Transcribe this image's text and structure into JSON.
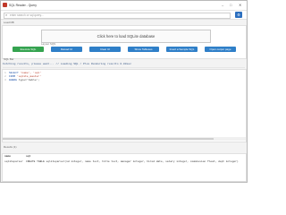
{
  "window": {
    "title": "SQL Reader - Query",
    "minimize_icon": "minimize-icon",
    "maximize_icon": "maximize-icon",
    "close_icon": "close-icon"
  },
  "search": {
    "placeholder": "enter search or sql query...",
    "icon": "search-icon",
    "settings_icon": "settings-icon"
  },
  "load_db": {
    "section_label": "Load DB",
    "drop_zone_text": "Click here to load SQLite database",
    "loaded_status": "Layout SQS"
  },
  "toolbar": {
    "execute_label": "Execute SQL",
    "reload_label": "Reload UI",
    "clear_label": "Clear UI",
    "show_tables_label": "Show Tableses",
    "insert_sample_label": "Insert a Sample SQL",
    "open_output_label": "Open output page"
  },
  "query": {
    "section_label": "SQL Bar",
    "status": "Fetching results, please wait... // Loading SQL / Plus Rendering results 0.00sec",
    "lines": [
      {
        "num": "1",
        "kw1": "SELECT",
        "rest1": " 'name', 'sql'"
      },
      {
        "num": "2",
        "kw1": "FROM",
        "rest1": " 'sqlite_master'"
      },
      {
        "num": "3",
        "kw1": "WHERE",
        "rest1": " type='table';"
      }
    ]
  },
  "results": {
    "section_label": "Results (1)",
    "columns": [
      "name",
      "sql"
    ],
    "rows": [
      [
        "sqliteparser",
        "CREATE TABLE sqliteparser(id integer, name text, title text, manager integer, hired date, salary integer, commission float, dept integer)"
      ]
    ]
  },
  "colors": {
    "primary_button": "#2f7fc8",
    "execute_button": "#35a350",
    "app_icon": "#c0392b"
  }
}
